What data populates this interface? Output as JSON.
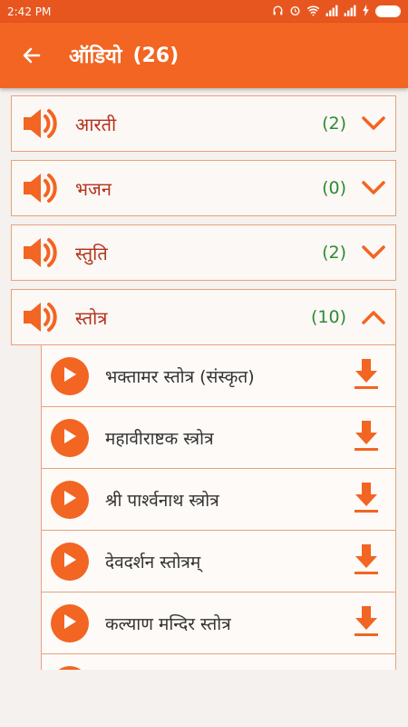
{
  "status_bar": {
    "time": "2:42 PM",
    "icons": [
      "headphones-icon",
      "alarm-icon",
      "wifi-icon",
      "signal-icon",
      "signal-icon",
      "charging-icon"
    ],
    "battery_level": 1.0
  },
  "app_bar": {
    "back_icon": "arrow-left-icon",
    "title": "ऑडियो",
    "count": "(26)"
  },
  "categories": [
    {
      "label": "आरती",
      "count": "(2)",
      "expanded": false
    },
    {
      "label": "भजन",
      "count": "(0)",
      "expanded": false
    },
    {
      "label": "स्तुति",
      "count": "(2)",
      "expanded": false
    },
    {
      "label": "स्तोत्र",
      "count": "(10)",
      "expanded": true
    }
  ],
  "tracks": [
    {
      "title": "भक्तामर स्तोत्र (संस्कृत)"
    },
    {
      "title": "महावीराष्टक स्त्रोत्र"
    },
    {
      "title": "श्री पार्श्वनाथ स्त्रोत्र"
    },
    {
      "title": "देवदर्शन स्तोत्रम्"
    },
    {
      "title": "कल्याण मन्दिर स्तोत्र"
    }
  ],
  "colors": {
    "primary": "#f26522",
    "status_bar": "#e8561f",
    "category_text": "#b5321c",
    "count_text": "#2f8a33",
    "border": "#e5a37d"
  }
}
